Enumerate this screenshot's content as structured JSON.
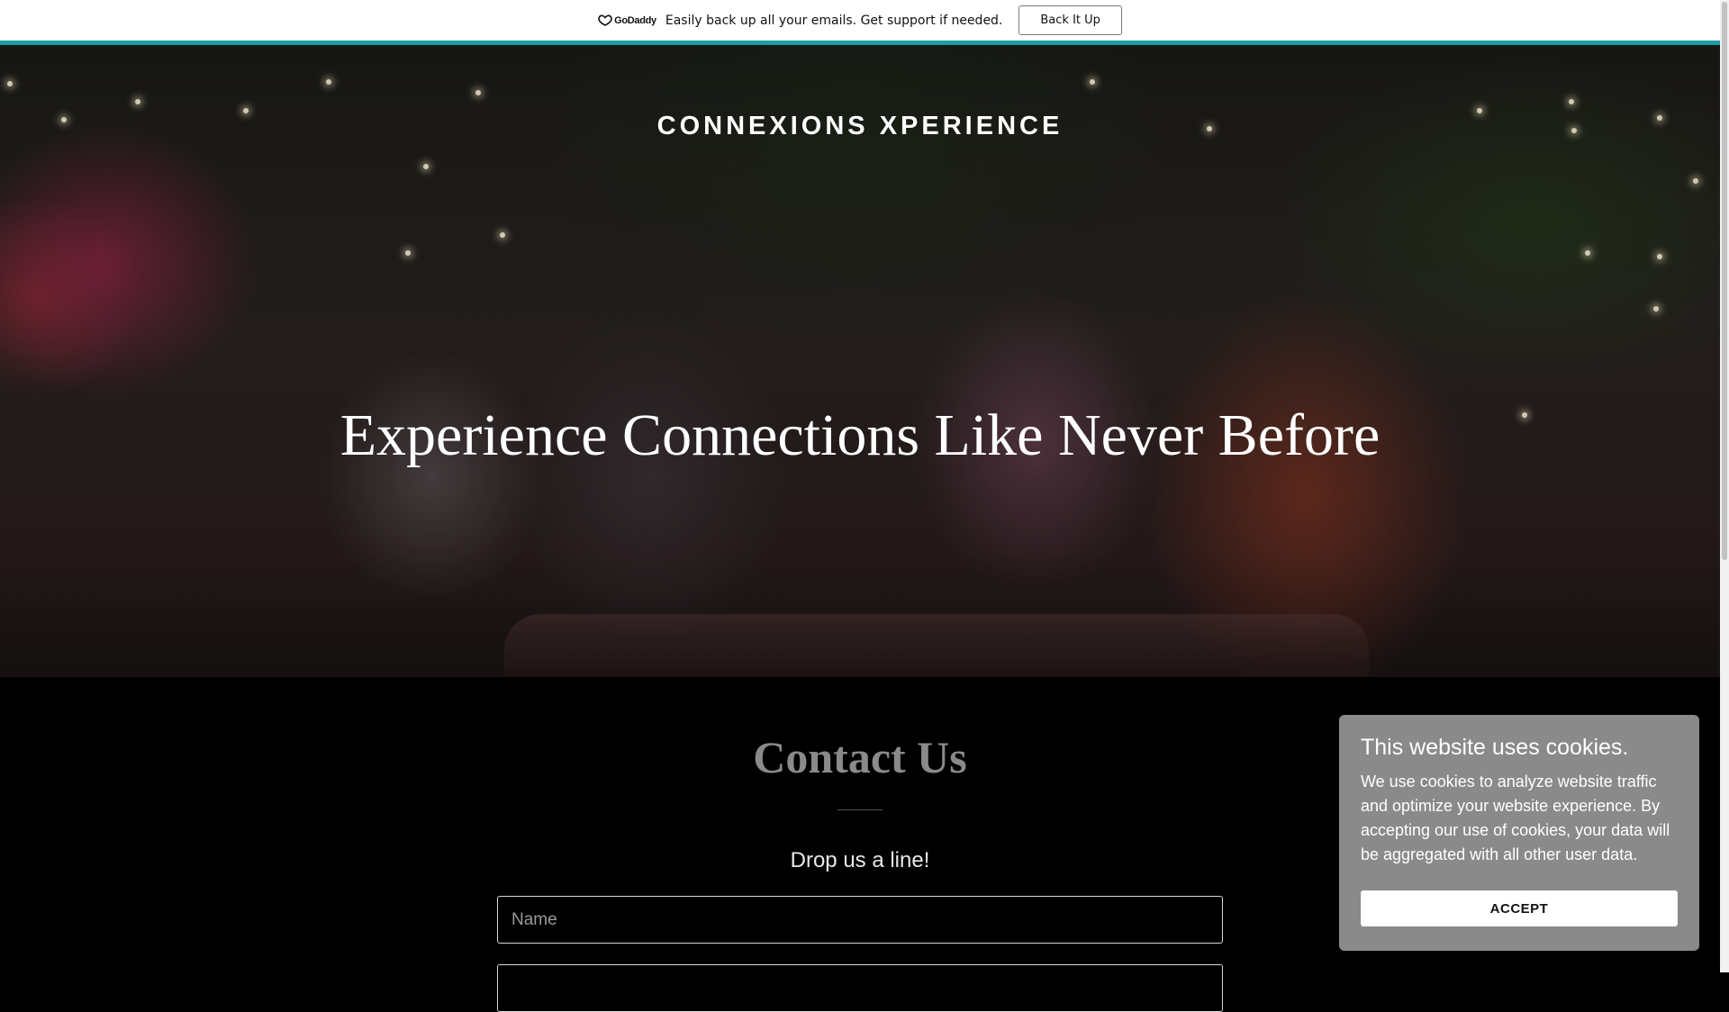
{
  "promo": {
    "logo_text": "GoDaddy",
    "message": "Easily back up all your emails. Get support if needed.",
    "button_label": "Back It Up",
    "accent_color": "#1a9ea3"
  },
  "hero": {
    "brand": "CONNEXIONS XPERIENCE",
    "headline": "Experience Connections Like Never Before"
  },
  "contact": {
    "title": "Contact Us",
    "subtitle": "Drop us a line!",
    "name_placeholder": "Name",
    "email_placeholder": ""
  },
  "cookie_banner": {
    "title": "This website uses cookies.",
    "body": "We use cookies to analyze website traffic and optimize your website experience. By accepting our use of cookies, your data will be aggregated with all other user data.",
    "accept_label": "ACCEPT",
    "background_color": "#8a8a8a"
  }
}
